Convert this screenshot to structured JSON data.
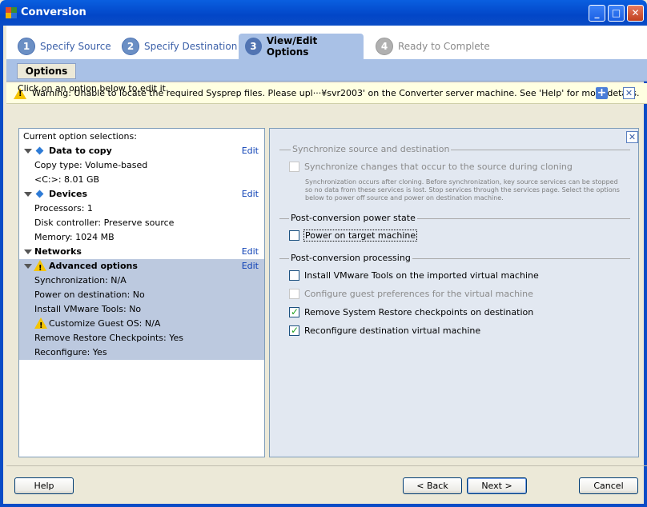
{
  "window": {
    "title": "Conversion",
    "controls": [
      "minimize",
      "maximize",
      "close"
    ]
  },
  "steps": [
    {
      "num": "1",
      "label": "Specify Source",
      "state": "done"
    },
    {
      "num": "2",
      "label": "Specify Destination",
      "state": "done"
    },
    {
      "num": "3",
      "label": "View/Edit Options",
      "state": "active"
    },
    {
      "num": "4",
      "label": "Ready to Complete",
      "state": "disabled"
    }
  ],
  "subtab": {
    "label": "Options"
  },
  "warning": {
    "text": "Warning: Unable to locate the required Sysprep files. Please upl···¥svr2003' on the Converter server machine. See 'Help' for more details."
  },
  "hint": "Click on an option below to edit it.",
  "left": {
    "header": "Current option selections:",
    "edit_label": "Edit",
    "groups": [
      {
        "title": "Data to copy",
        "items": [
          "Copy type: Volume-based",
          "<C:>: 8.01 GB"
        ]
      },
      {
        "title": "Devices",
        "items": [
          "Processors: 1",
          "Disk controller: Preserve source",
          "Memory: 1024 MB"
        ]
      },
      {
        "title": "Networks",
        "items": []
      },
      {
        "title": "Advanced options",
        "items": [
          "Synchronization: N/A",
          "Power on destination: No",
          "Install VMware Tools: No",
          "Customize Guest OS: N/A",
          "Remove Restore Checkpoints: Yes",
          "Reconfigure: Yes"
        ]
      }
    ]
  },
  "right": {
    "sync_section": "Synchronize source and destination",
    "sync_checkbox": "Synchronize changes that occur to the source during cloning",
    "sync_note": "Synchronization occurs after cloning. Before synchronization, key source services can be stopped so no data from these services is lost. Stop services through the services page. Select the options below to power off source and power on destination machine.",
    "power_section": "Post-conversion power state",
    "power_checkbox": "Power on target machine",
    "processing_section": "Post-conversion processing",
    "processing": [
      {
        "label": "Install VMware Tools on the imported virtual machine",
        "checked": false,
        "enabled": true
      },
      {
        "label": "Configure guest preferences for the virtual machine",
        "checked": false,
        "enabled": false
      },
      {
        "label": "Remove System Restore checkpoints on destination",
        "checked": true,
        "enabled": true
      },
      {
        "label": "Reconfigure destination virtual machine",
        "checked": true,
        "enabled": true
      }
    ]
  },
  "buttons": {
    "help": "Help",
    "back": "< Back",
    "next": "Next >",
    "cancel": "Cancel"
  }
}
